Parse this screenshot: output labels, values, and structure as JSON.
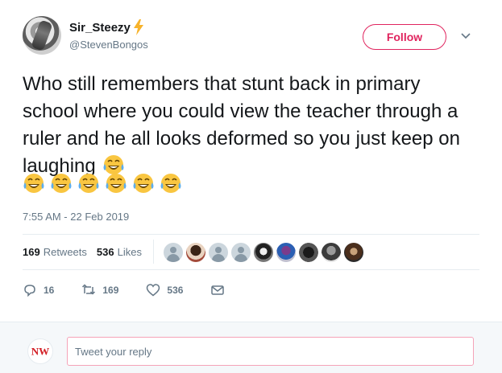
{
  "author": {
    "display_name": "Sir_Steezy",
    "handle": "@StevenBongos"
  },
  "header": {
    "follow_label": "Follow"
  },
  "tweet": {
    "text": "Who still remembers that stunt back in primary school where you could view the teacher through a ruler and he all looks deformed so you just keep on laughing",
    "trailing_emoji": "face-with-tears-of-joy",
    "emoji_row_count": 6,
    "timestamp": "7:55 AM - 22 Feb 2019"
  },
  "stats": {
    "retweets_count": "169",
    "retweets_label": "Retweets",
    "likes_count": "536",
    "likes_label": "Likes"
  },
  "actions": {
    "reply_count": "16",
    "retweet_count": "169",
    "like_count": "536"
  },
  "reply": {
    "placeholder": "Tweet your reply",
    "avatar_text": "NW"
  },
  "colors": {
    "accent": "#e0245e",
    "muted": "#657786",
    "bolt": "#f7b32b"
  }
}
